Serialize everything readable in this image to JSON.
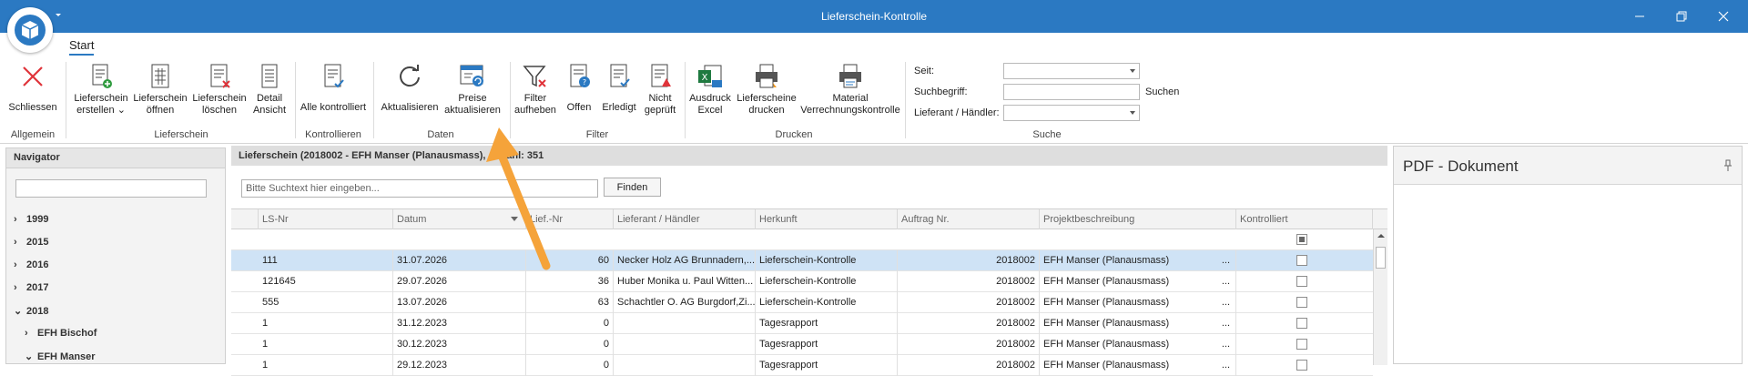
{
  "window": {
    "title": "Lieferschein-Kontrolle"
  },
  "ribbon": {
    "tab": "Start",
    "groups": {
      "allgemein": "Allgemein",
      "lieferschein": "Lieferschein",
      "kontrollieren": "Kontrollieren",
      "daten": "Daten",
      "filter": "Filter",
      "drucken": "Drucken",
      "suche": "Suche"
    },
    "buttons": {
      "schliessen": "Schliessen",
      "ls_erstellen_1": "Lieferschein",
      "ls_erstellen_2": "erstellen",
      "ls_oeffnen_1": "Lieferschein",
      "ls_oeffnen_2": "öffnen",
      "ls_loeschen_1": "Lieferschein",
      "ls_loeschen_2": "löschen",
      "detail_1": "Detail",
      "detail_2": "Ansicht",
      "alle_kontrolliert": "Alle kontrolliert",
      "aktualisieren": "Aktualisieren",
      "preise_1": "Preise",
      "preise_2": "aktualisieren",
      "filter_1": "Filter",
      "filter_2": "aufheben",
      "offen": "Offen",
      "erledigt": "Erledigt",
      "nicht_1": "Nicht",
      "nicht_2": "geprüft",
      "ausdruck_1": "Ausdruck",
      "ausdruck_2": "Excel",
      "ls_drucken_1": "Lieferscheine",
      "ls_drucken_2": "drucken",
      "material_1": "Material",
      "material_2": "Verrechnungskontrolle"
    },
    "search": {
      "seit_label": "Seit:",
      "suchbegriff_label": "Suchbegriff:",
      "lieferant_label": "Lieferant / Händler:",
      "suchen_label": "Suchen",
      "seit_value": "",
      "suchbegriff_value": "",
      "lieferant_value": ""
    }
  },
  "navigator": {
    "title": "Navigator",
    "search_value": "",
    "items": [
      {
        "label": "1999",
        "chevron": "›"
      },
      {
        "label": "2015",
        "chevron": "›"
      },
      {
        "label": "2016",
        "chevron": "›"
      },
      {
        "label": "2017",
        "chevron": "›"
      },
      {
        "label": "2018",
        "chevron": "⌄"
      },
      {
        "label": "EFH Bischof",
        "chevron": "›"
      },
      {
        "label": "EFH Manser",
        "chevron": "⌄"
      }
    ]
  },
  "main": {
    "header": "Lieferschein (2018002 - EFH Manser (Planausmass), Anzahl: 351",
    "search_placeholder": "Bitte Suchtext hier eingeben...",
    "find_label": "Finden",
    "columns": [
      "LS-Nr",
      "Datum",
      "Lief.-Nr",
      "Lieferant / Händler",
      "Herkunft",
      "Auftrag Nr.",
      "Projektbeschreibung",
      "Kontrolliert"
    ],
    "rows": [
      {
        "ls_nr": "111",
        "datum": "31.07.2026",
        "lief_nr": "60",
        "lieferant": "Necker Holz AG Brunnadern,...",
        "herkunft": "Lieferschein-Kontrolle",
        "auftrag": "2018002",
        "projekt": "EFH Manser (Planausmass)",
        "more": "...",
        "selected": true
      },
      {
        "ls_nr": "121645",
        "datum": "29.07.2026",
        "lief_nr": "36",
        "lieferant": "Huber Monika u. Paul Witten...",
        "herkunft": "Lieferschein-Kontrolle",
        "auftrag": "2018002",
        "projekt": "EFH Manser (Planausmass)",
        "more": "...",
        "selected": false
      },
      {
        "ls_nr": "555",
        "datum": "13.07.2026",
        "lief_nr": "63",
        "lieferant": "Schachtler O. AG Burgdorf,Zi...",
        "herkunft": "Lieferschein-Kontrolle",
        "auftrag": "2018002",
        "projekt": "EFH Manser (Planausmass)",
        "more": "...",
        "selected": false
      },
      {
        "ls_nr": "1",
        "datum": "31.12.2023",
        "lief_nr": "0",
        "lieferant": "",
        "herkunft": "Tagesrapport",
        "auftrag": "2018002",
        "projekt": "EFH Manser (Planausmass)",
        "more": "...",
        "selected": false
      },
      {
        "ls_nr": "1",
        "datum": "30.12.2023",
        "lief_nr": "0",
        "lieferant": "",
        "herkunft": "Tagesrapport",
        "auftrag": "2018002",
        "projekt": "EFH Manser (Planausmass)",
        "more": "...",
        "selected": false
      },
      {
        "ls_nr": "1",
        "datum": "29.12.2023",
        "lief_nr": "0",
        "lieferant": "",
        "herkunft": "Tagesrapport",
        "auftrag": "2018002",
        "projekt": "EFH Manser (Planausmass)",
        "more": "...",
        "selected": false
      }
    ]
  },
  "pdf": {
    "title": "PDF - Dokument"
  },
  "colors": {
    "titlebar": "#2b79c2",
    "selected_row": "#cfe3f6",
    "annotation_arrow": "#f5a33a"
  }
}
